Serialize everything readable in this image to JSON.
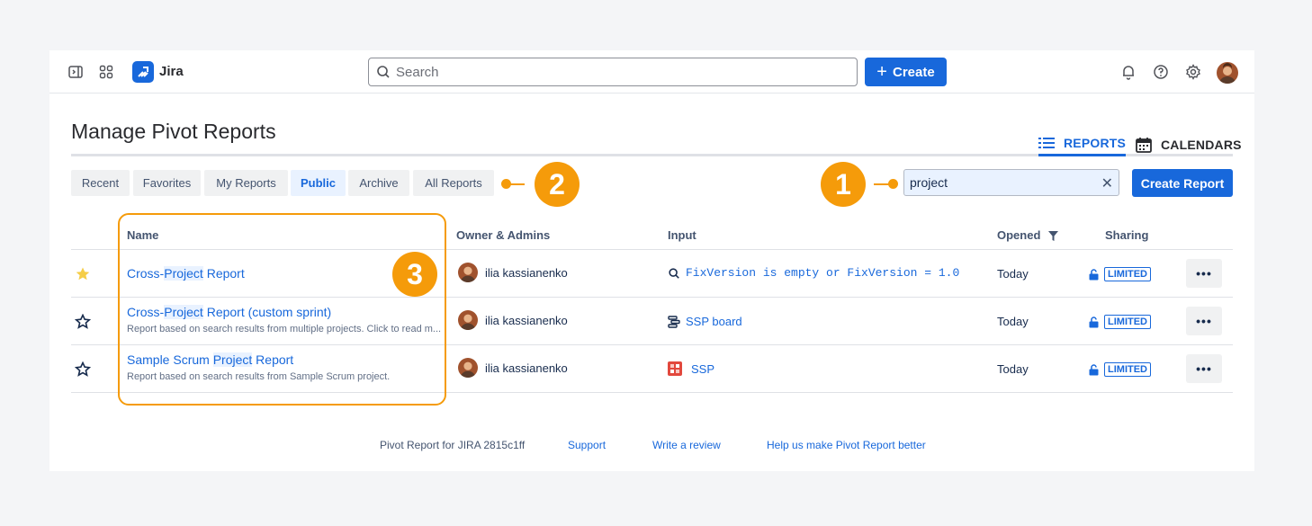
{
  "app": {
    "name": "Jira"
  },
  "search": {
    "placeholder": "Search"
  },
  "toolbar": {
    "create_label": "Create"
  },
  "page": {
    "title": "Manage Pivot Reports"
  },
  "view_tabs": [
    {
      "label": "REPORTS",
      "active": true
    },
    {
      "label": "CALENDARS",
      "active": false
    }
  ],
  "filter_tabs": [
    "Recent",
    "Favorites",
    "My Reports",
    "Public",
    "Archive",
    "All Reports"
  ],
  "selected_filter_tab": "Public",
  "report_filter": {
    "value": "project"
  },
  "create_report_label": "Create Report",
  "callouts": [
    "1",
    "2",
    "3"
  ],
  "table": {
    "columns": [
      "Name",
      "Owner & Admins",
      "Input",
      "Opened",
      "Sharing"
    ],
    "rows": [
      {
        "favorite": true,
        "name_parts": [
          "Cross-",
          "Project",
          " Report"
        ],
        "description": "",
        "owner": "ilia kassianenko",
        "input_type": "search-icon",
        "input": "FixVersion is empty or FixVersion = 1.0",
        "opened": "Today",
        "sharing": "LIMITED"
      },
      {
        "favorite": false,
        "name_parts": [
          "Cross-",
          "Project",
          " Report (custom sprint)"
        ],
        "description": "Report based on search results from multiple projects. Click to read m...",
        "owner": "ilia kassianenko",
        "input_type": "board-icon",
        "input": "SSP board",
        "opened": "Today",
        "sharing": "LIMITED"
      },
      {
        "favorite": false,
        "name_parts": [
          "Sample Scrum ",
          "Project",
          " Report"
        ],
        "description": "Report based on search results from Sample Scrum project.",
        "owner": "ilia kassianenko",
        "input_type": "project-icon",
        "input": "SSP",
        "opened": "Today",
        "sharing": "LIMITED"
      }
    ]
  },
  "footer": {
    "version": "Pivot Report for JIRA 2815c1ff",
    "links": [
      "Support",
      "Write a review",
      "Help us make Pivot Report better"
    ]
  },
  "colors": {
    "accent": "#1868db",
    "callout": "#f59b0a",
    "favorite": "#f5cd47"
  }
}
